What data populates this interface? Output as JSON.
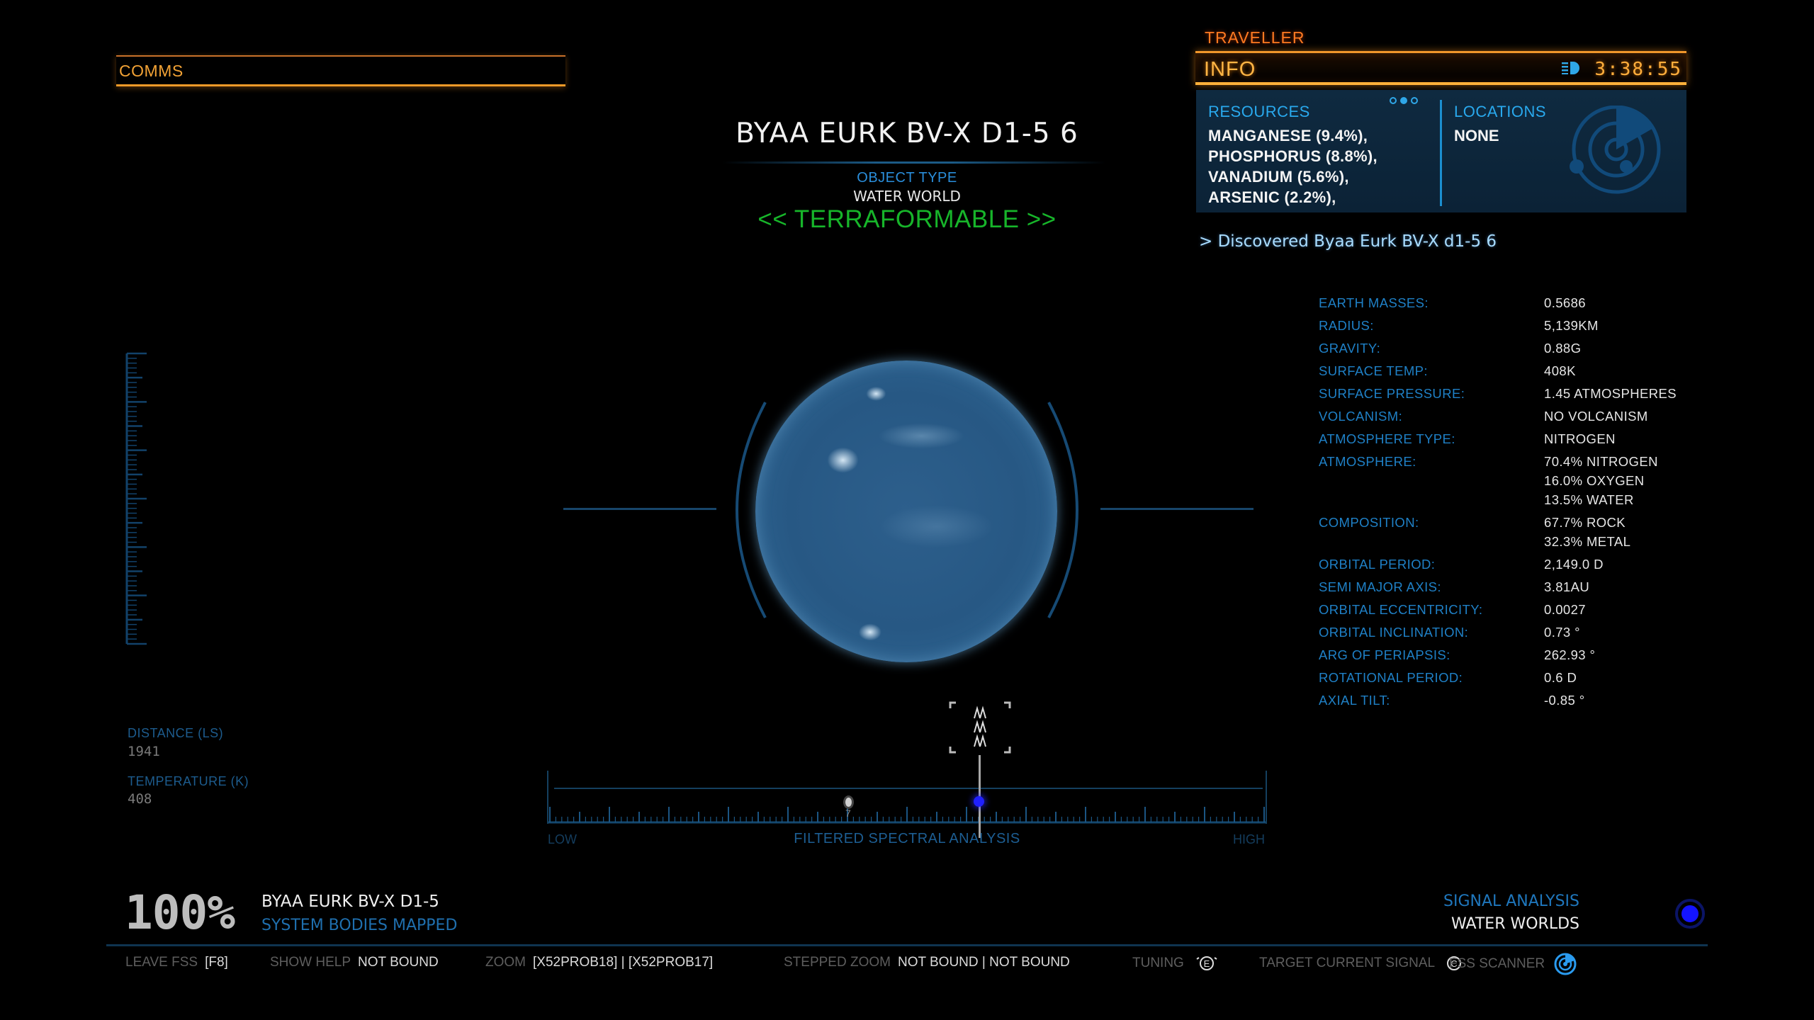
{
  "comms": {
    "label": "COMMS"
  },
  "info_panel": {
    "header": "TRAVELLER",
    "title": "INFO",
    "clock": "3:38:55",
    "headlight_icon": "headlight-icon",
    "pager": {
      "pages": 3,
      "active_page": 2
    },
    "resources": {
      "title": "RESOURCES",
      "items": [
        "MANGANESE (9.4%),",
        "PHOSPHORUS (8.8%),",
        "VANADIUM (5.6%),",
        "ARSENIC (2.2%),"
      ]
    },
    "locations": {
      "title": "LOCATIONS",
      "value": "NONE",
      "icon": "radar-icon"
    },
    "colors": {
      "orange": "#f0962a",
      "blue": "#29a9ee",
      "panel_bg": "#0f2a40"
    }
  },
  "discovery_message": "> Discovered Byaa Eurk BV-X d1-5 6",
  "stats": [
    {
      "label": "EARTH MASSES:",
      "values": [
        "0.5686"
      ]
    },
    {
      "label": "RADIUS:",
      "values": [
        "5,139KM"
      ]
    },
    {
      "label": "GRAVITY:",
      "values": [
        "0.88G"
      ]
    },
    {
      "label": "SURFACE TEMP:",
      "values": [
        "408K"
      ]
    },
    {
      "label": "SURFACE PRESSURE:",
      "values": [
        "1.45 ATMOSPHERES"
      ]
    },
    {
      "label": "VOLCANISM:",
      "values": [
        "NO VOLCANISM"
      ]
    },
    {
      "label": "ATMOSPHERE TYPE:",
      "values": [
        "NITROGEN"
      ]
    },
    {
      "label": "ATMOSPHERE:",
      "values": [
        "70.4% NITROGEN",
        "16.0% OXYGEN",
        "13.5% WATER"
      ]
    },
    {
      "label": "COMPOSITION:",
      "values": [
        "67.7% ROCK",
        "32.3% METAL"
      ]
    },
    {
      "label": "ORBITAL PERIOD:",
      "values": [
        "2,149.0 D"
      ]
    },
    {
      "label": "SEMI MAJOR AXIS:",
      "values": [
        "3.81AU"
      ]
    },
    {
      "label": "ORBITAL ECCENTRICITY:",
      "values": [
        "0.0027"
      ]
    },
    {
      "label": "ORBITAL INCLINATION:",
      "values": [
        "0.73 °"
      ]
    },
    {
      "label": "ARG OF PERIAPSIS:",
      "values": [
        "262.93 °"
      ]
    },
    {
      "label": "ROTATIONAL PERIOD:",
      "values": [
        "0.6 D"
      ]
    },
    {
      "label": "AXIAL TILT:",
      "values": [
        "-0.85 °"
      ]
    }
  ],
  "body": {
    "name": "BYAA EURK BV-X D1-5 6",
    "object_type_label": "OBJECT TYPE",
    "object_type": "WATER WORLD",
    "terraform_status": "<< TERRAFORMABLE >>",
    "terraform_color": "#17b52a"
  },
  "left_readouts": {
    "distance_label": "DISTANCE (LS)",
    "distance_value": "1941",
    "temperature_label": "TEMPERATURE (K)",
    "temperature_value": "408"
  },
  "spectrum": {
    "title": "FILTERED SPECTRAL ANALYSIS",
    "low_label": "LOW",
    "high_label": "HIGH",
    "tuner_position": 0.61,
    "signals": [
      {
        "position": 0.42,
        "count": "7"
      }
    ]
  },
  "progress": {
    "percent": "100%",
    "system": "BYAA EURK BV-X D1-5",
    "label": "SYSTEM BODIES MAPPED"
  },
  "signal": {
    "label": "SIGNAL ANALYSIS",
    "type": "WATER WORLDS",
    "color": "#1414ff"
  },
  "keybar": [
    {
      "label": "LEAVE FSS",
      "binding": "[F8]"
    },
    {
      "label": "SHOW HELP",
      "binding": "NOT BOUND"
    },
    {
      "label": "ZOOM",
      "binding": "[X52PROB18] | [X52PROB17]"
    },
    {
      "label": "STEPPED ZOOM",
      "binding": "NOT BOUND | NOT BOUND"
    },
    {
      "label": "TUNING",
      "binding": "",
      "icon": "e-key-icon"
    },
    {
      "label": "TARGET CURRENT SIGNAL",
      "binding": "",
      "icon": "c-key-icon"
    }
  ],
  "fss_scanner": {
    "label": "FSS SCANNER",
    "icon": "fss-scanner-icon"
  }
}
